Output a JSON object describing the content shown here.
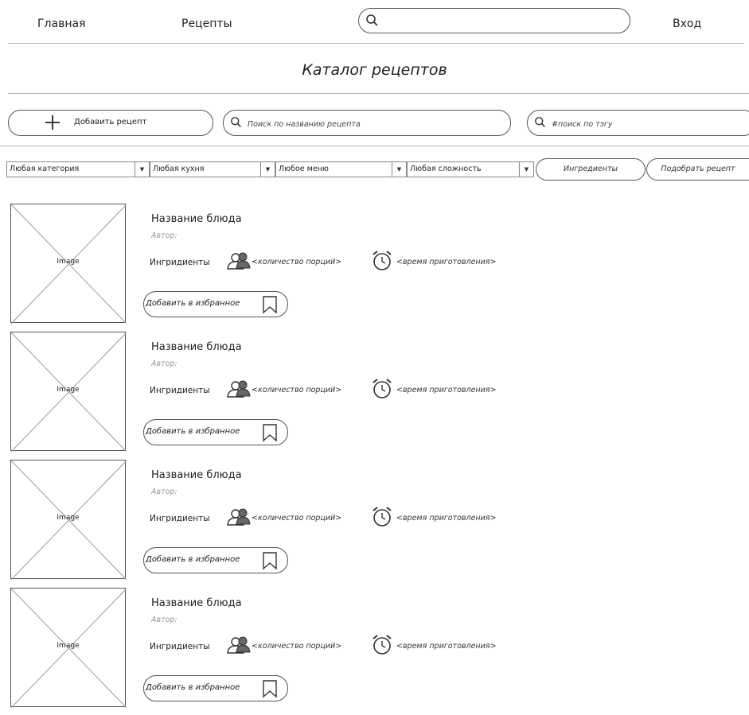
{
  "nav": {
    "home": "Главная",
    "recipes": "Рецепты",
    "search_placeholder": "",
    "login": "Вход"
  },
  "page": {
    "title": "Каталог рецептов"
  },
  "toolbar": {
    "add_recipe": "Добавить рецепт",
    "name_search_placeholder": "Поиск по названию рецепта",
    "tag_search_placeholder": "#поиск по тэгу"
  },
  "filters": {
    "category": "Любая категория",
    "cuisine": "Любая кухня",
    "menu": "Любое меню",
    "difficulty": "Любая сложность",
    "ingredients_button": "Ингредиенты",
    "pick_recipe_button": "Подобрать рецепт"
  },
  "recipes": [
    {
      "image_label": "Image",
      "name": "Название блюда",
      "author": "Автор:",
      "ingredients": "Ингридиенты",
      "portions": "<количество порций>",
      "time": "<время приготовления>",
      "favorite": "Добавить в избранное"
    },
    {
      "image_label": "Image",
      "name": "Название блюда",
      "author": "Автор:",
      "ingredients": "Ингридиенты",
      "portions": "<количество порций>",
      "time": "<время приготовления>",
      "favorite": "Добавить в избранное"
    },
    {
      "image_label": "Image",
      "name": "Название блюда",
      "author": "Автор:",
      "ingredients": "Ингридиенты",
      "portions": "<количество порций>",
      "time": "<время приготовления>",
      "favorite": "Добавить в избранное"
    },
    {
      "image_label": "Image",
      "name": "Название блюда",
      "author": "Автор:",
      "ingredients": "Ингридиенты",
      "portions": "<количество порций>",
      "time": "<время приготовления>",
      "favorite": "Добавить в избранное"
    }
  ],
  "icons": {
    "search": "search-icon",
    "add": "plus-icon",
    "portions": "people-icon",
    "time": "alarm-clock-icon",
    "favorite": "bookmark-icon"
  },
  "colors": {
    "outline": "#555555",
    "divider": "#b9b9b9",
    "muted_text": "#999999"
  }
}
